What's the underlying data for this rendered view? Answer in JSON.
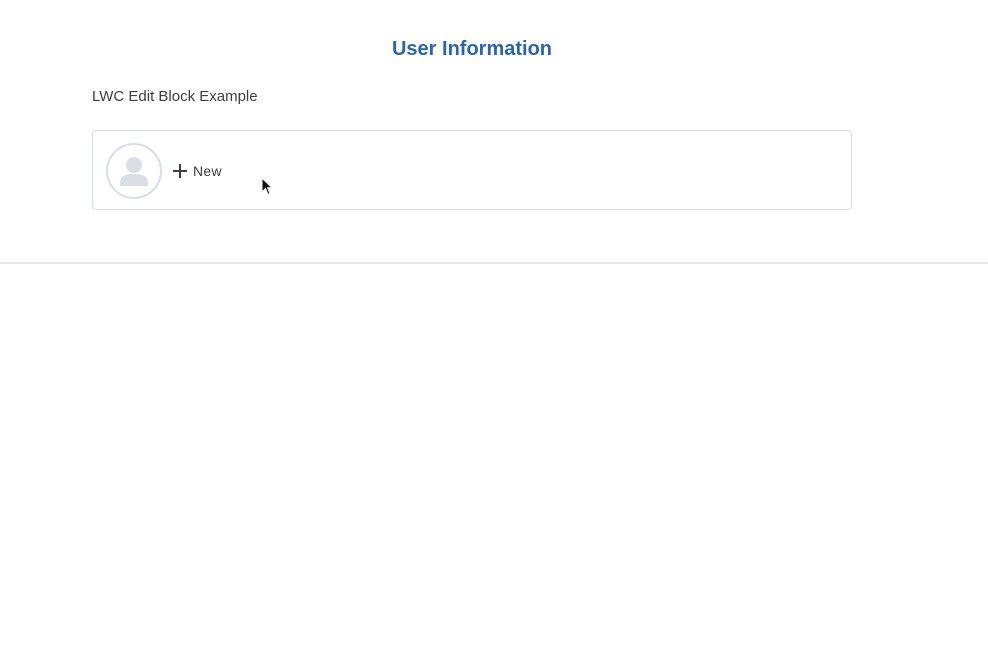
{
  "page": {
    "title": "User Information",
    "subtitle": "LWC Edit Block Example"
  },
  "card": {
    "avatar_icon": "user-avatar-icon",
    "new_button": {
      "icon": "plus-icon",
      "label": "New"
    }
  },
  "colors": {
    "title": "#2a64b0",
    "text": "#3e3e3c",
    "border": "#d8dde6",
    "avatar_fill": "#d8dde6"
  }
}
